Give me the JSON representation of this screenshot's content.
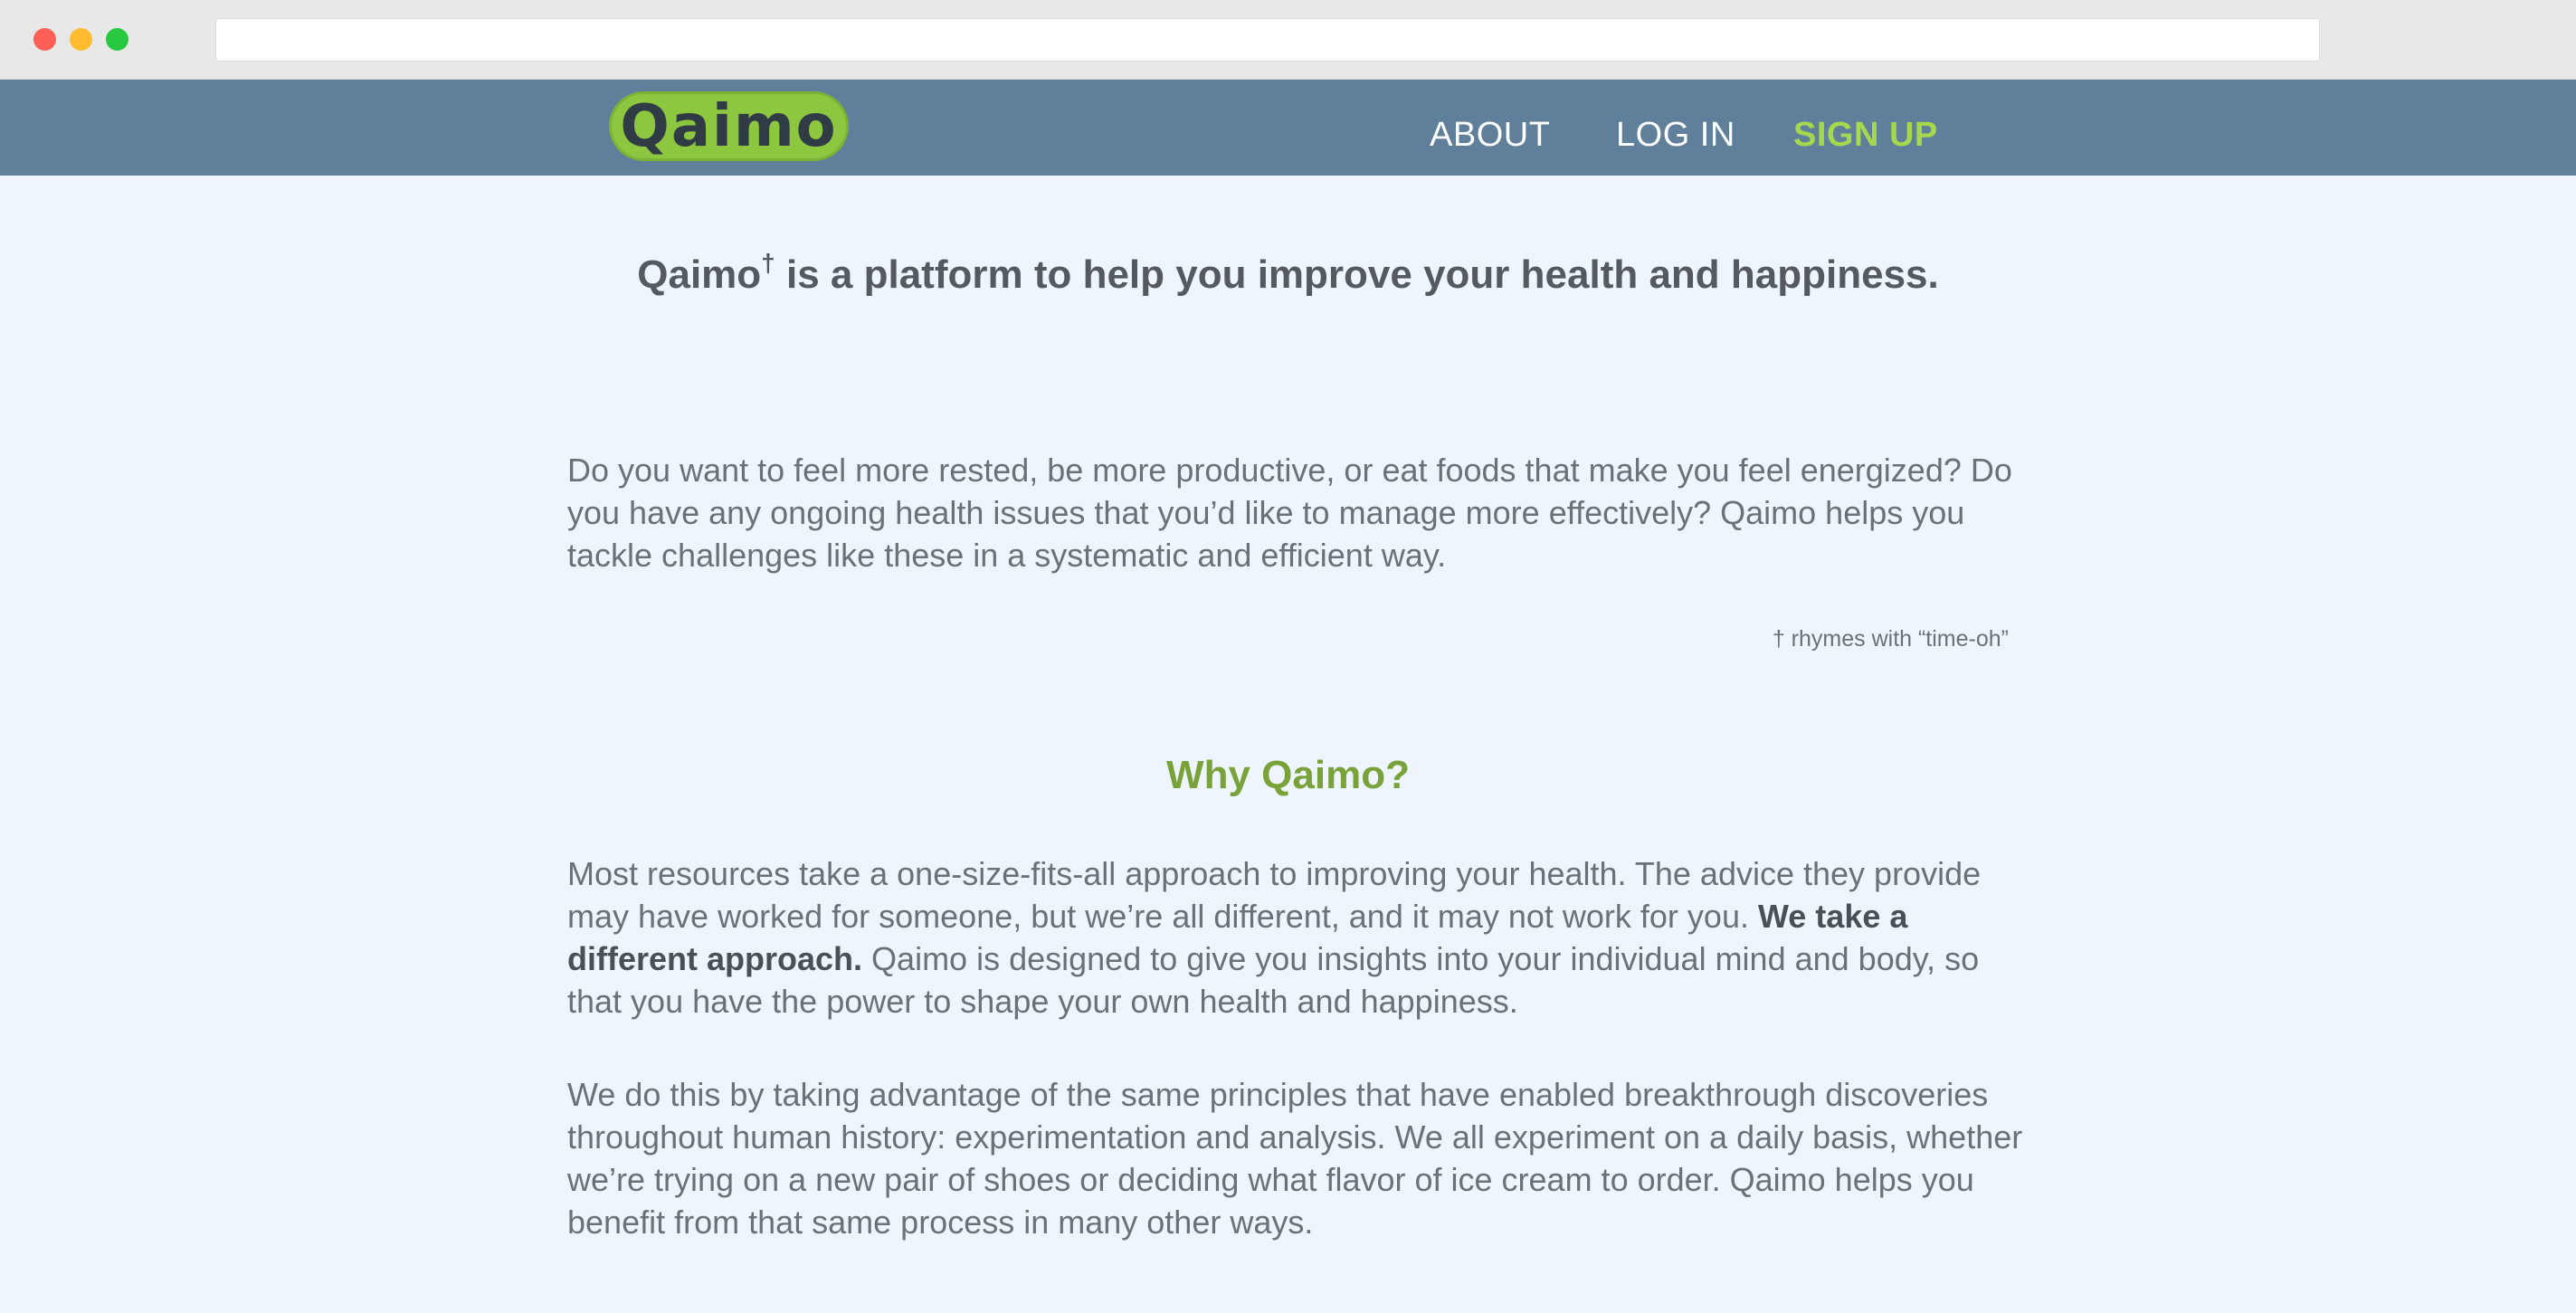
{
  "nav": {
    "logo_text": "Qaimo",
    "about": "ABOUT",
    "login": "LOG IN",
    "signup": "SIGN UP"
  },
  "hero": {
    "tagline_brand": "Qaimo",
    "tagline_mark": "†",
    "tagline_rest": " is a platform to help you improve your health and happiness."
  },
  "intro": {
    "paragraph": "Do you want to feel more rested, be more productive, or eat foods that make you feel energized? Do you have any ongoing health issues that you’d like to manage more effectively? Qaimo helps you tackle challenges like these in a systematic and efficient way.",
    "footnote": "† rhymes with “time-oh”"
  },
  "why": {
    "heading": "Why Qaimo?",
    "para1_start": "Most resources take a one-size-fits-all approach to improving your health. The advice they provide may have worked for someone, but we’re all different, and it may not work for you. ",
    "para1_bold": "We take a different approach.",
    "para1_end": " Qaimo is designed to give you insights into your individual mind and body, so that you have the power to shape your own health and happiness.",
    "para2": "We do this by taking advantage of the same principles that have enabled breakthrough discoveries throughout human history: experimentation and analysis. We all experiment on a daily basis, whether we’re trying on a new pair of shoes or deciding what flavor of ice cream to order. Qaimo helps you benefit from that same process in many other ways."
  },
  "colors": {
    "header_bg": "#5f7f9b",
    "logo_bg": "#8dc63f",
    "accent_green": "#a6d84e",
    "heading_green": "#79a33a",
    "page_bg": "#eef5fc"
  }
}
